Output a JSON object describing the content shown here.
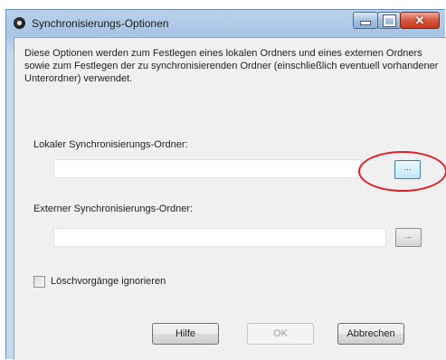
{
  "window": {
    "title": "Synchronisierungs-Optionen",
    "controls": {
      "minimize": "minimize",
      "maximize": "maximize",
      "close": "✕"
    }
  },
  "description": "Diese Optionen werden zum Festlegen eines lokalen Ordners und eines externen Ordners sowie zum Festlegen der zu synchronisierenden Ordner (einschließlich eventuell vorhandener Unterordner) verwendet.",
  "local_folder": {
    "label": "Lokaler Synchronisierungs-Ordner:",
    "value": "",
    "browse_label": "..."
  },
  "external_folder": {
    "label": "Externer Synchronisierungs-Ordner:",
    "value": "",
    "browse_label": "..."
  },
  "ignore_deletes": {
    "label": "Löschvorgänge ignorieren",
    "checked": false
  },
  "buttons": {
    "help": "Hilfe",
    "ok": "OK",
    "cancel": "Abbrechen"
  },
  "annotation": {
    "ring_color": "#e0202a"
  }
}
